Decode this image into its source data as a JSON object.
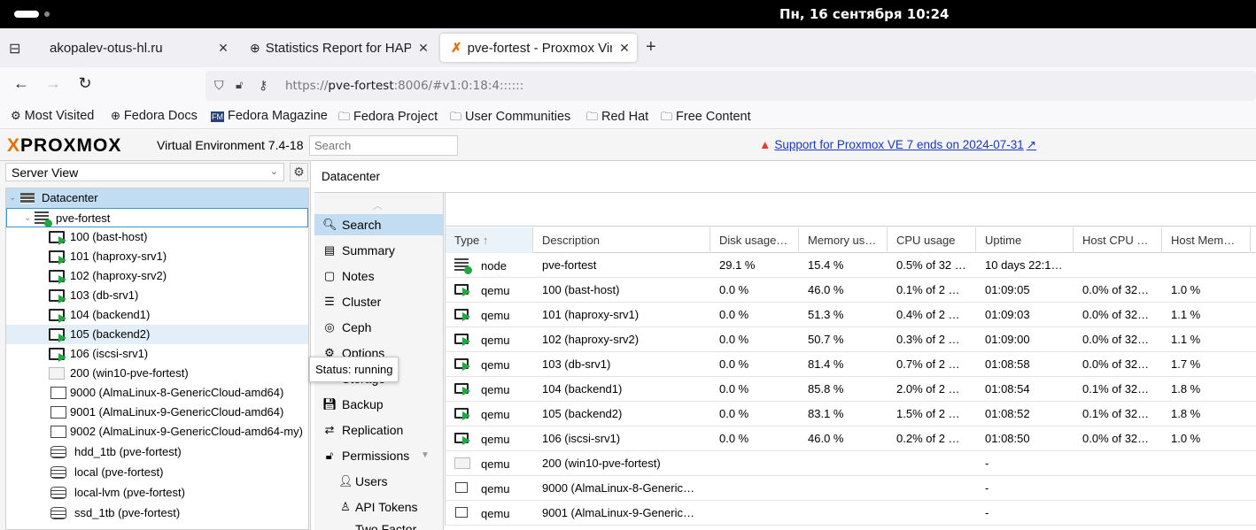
{
  "system": {
    "clock": "Пн, 16 сентября  10:24"
  },
  "browser": {
    "tabs": [
      {
        "title": "akopalev-otus-hl.ru"
      },
      {
        "title": "Statistics Report for HAProxy"
      },
      {
        "title": "pve-fortest - Proxmox Virtual Environment"
      }
    ],
    "url_prefix": "https://",
    "url_host": "pve-fortest",
    "url_rest": ":8006/#v1:0:18:4::::::",
    "bookmarks": [
      "Most Visited",
      "Fedora Docs",
      "Fedora Magazine",
      "Fedora Project",
      "User Communities",
      "Red Hat",
      "Free Content"
    ]
  },
  "proxmox": {
    "brand_x": "X",
    "brand": "PROXMOX",
    "version": "Virtual Environment 7.4-18",
    "search_placeholder": "Search",
    "support_notice": "Support for Proxmox VE 7 ends on 2024-07-31",
    "view_selector": "Server View",
    "tree": [
      {
        "label": "Datacenter"
      },
      {
        "label": "pve-fortest"
      },
      {
        "label": "100 (bast-host)"
      },
      {
        "label": "101 (haproxy-srv1)"
      },
      {
        "label": "102 (haproxy-srv2)"
      },
      {
        "label": "103 (db-srv1)"
      },
      {
        "label": "104 (backend1)"
      },
      {
        "label": "105 (backend2)"
      },
      {
        "label": "106 (iscsi-srv1)"
      },
      {
        "label": "200 (win10-pve-fortest)"
      },
      {
        "label": "9000 (AlmaLinux-8-GenericCloud-amd64)"
      },
      {
        "label": "9001 (AlmaLinux-9-GenericCloud-amd64)"
      },
      {
        "label": "9002 (AlmaLinux-9-GenericCloud-amd64-my)"
      },
      {
        "label": "hdd_1tb (pve-fortest)"
      },
      {
        "label": "local (pve-fortest)"
      },
      {
        "label": "local-lvm (pve-fortest)"
      },
      {
        "label": "ssd_1tb (pve-fortest)"
      }
    ],
    "breadcrumb": "Datacenter",
    "menu": [
      "Search",
      "Summary",
      "Notes",
      "Cluster",
      "Ceph",
      "Options",
      "Storage",
      "Backup",
      "Replication",
      "Permissions",
      "Users",
      "API Tokens",
      "Two Factor"
    ],
    "tooltip": "Status: running",
    "columns": [
      "Type",
      "Description",
      "Disk usage…",
      "Memory us…",
      "CPU usage",
      "Uptime",
      "Host CPU …",
      "Host Mem…"
    ],
    "rows": [
      [
        "node",
        "pve-fortest",
        "29.1 %",
        "15.4 %",
        "0.5% of 32 …",
        "10 days 22:1…",
        "",
        ""
      ],
      [
        "qemu",
        "100 (bast-host)",
        "0.0 %",
        "46.0 %",
        "0.1% of 2 …",
        "01:09:05",
        "0.0% of 32…",
        "1.0 %"
      ],
      [
        "qemu",
        "101 (haproxy-srv1)",
        "0.0 %",
        "51.3 %",
        "0.4% of 2 …",
        "01:09:03",
        "0.0% of 32…",
        "1.1 %"
      ],
      [
        "qemu",
        "102 (haproxy-srv2)",
        "0.0 %",
        "50.7 %",
        "0.3% of 2 …",
        "01:09:00",
        "0.0% of 32…",
        "1.1 %"
      ],
      [
        "qemu",
        "103 (db-srv1)",
        "0.0 %",
        "81.4 %",
        "0.7% of 2 …",
        "01:08:58",
        "0.0% of 32…",
        "1.7 %"
      ],
      [
        "qemu",
        "104 (backend1)",
        "0.0 %",
        "85.8 %",
        "2.0% of 2 …",
        "01:08:54",
        "0.1% of 32…",
        "1.8 %"
      ],
      [
        "qemu",
        "105 (backend2)",
        "0.0 %",
        "83.1 %",
        "1.5% of 2 …",
        "01:08:52",
        "0.1% of 32…",
        "1.8 %"
      ],
      [
        "qemu",
        "106 (iscsi-srv1)",
        "0.0 %",
        "46.0 %",
        "0.2% of 2 …",
        "01:08:50",
        "0.0% of 32…",
        "1.0 %"
      ],
      [
        "qemu",
        "200 (win10-pve-fortest)",
        "",
        "",
        "",
        "-",
        "",
        ""
      ],
      [
        "qemu",
        "9000 (AlmaLinux-8-Generic…",
        "",
        "",
        "",
        "-",
        "",
        ""
      ],
      [
        "qemu",
        "9001 (AlmaLinux-9-Generic…",
        "",
        "",
        "",
        "-",
        "",
        ""
      ]
    ]
  }
}
